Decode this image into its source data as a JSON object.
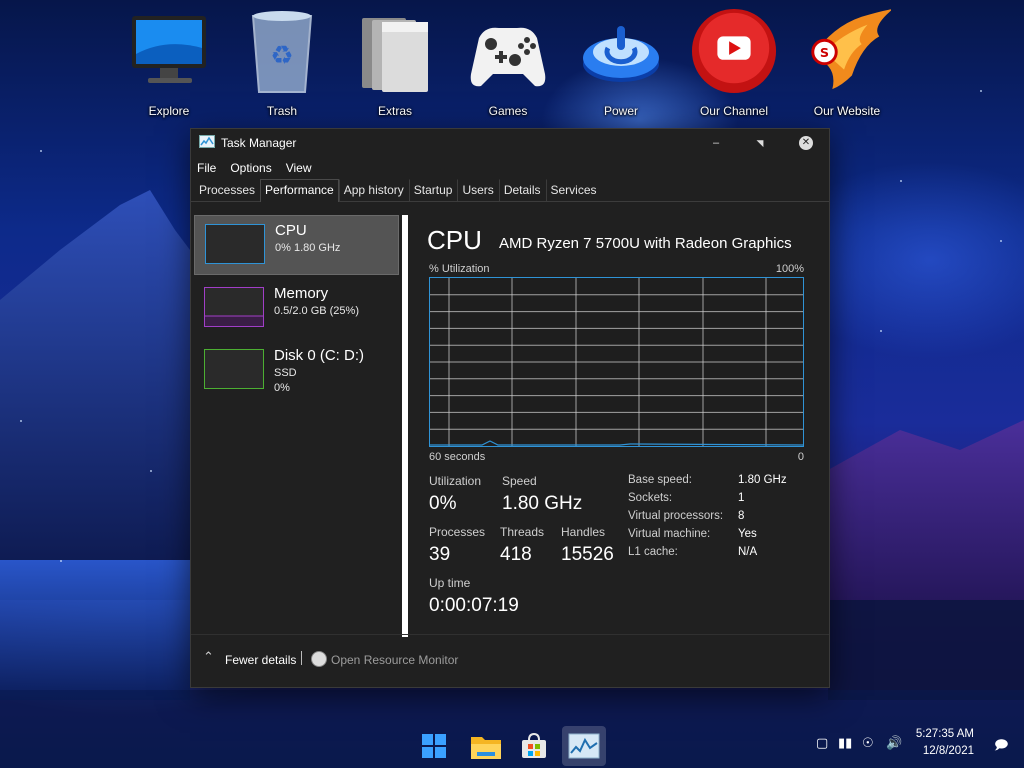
{
  "desktop": {
    "icons": [
      {
        "label": "Explore"
      },
      {
        "label": "Trash"
      },
      {
        "label": "Extras"
      },
      {
        "label": "Games"
      },
      {
        "label": "Power"
      },
      {
        "label": "Our Channel"
      },
      {
        "label": "Our Website"
      }
    ]
  },
  "window": {
    "title": "Task Manager",
    "menu": [
      "File",
      "Options",
      "View"
    ],
    "tabs": [
      "Processes",
      "Performance",
      "App history",
      "Startup",
      "Users",
      "Details",
      "Services"
    ],
    "active_tab": "Performance"
  },
  "sidebar": {
    "items": [
      {
        "name": "CPU",
        "line1": "0%  1.80 GHz",
        "line2": "",
        "color": "#2f93d6",
        "selected": true
      },
      {
        "name": "Memory",
        "line1": "0.5/2.0 GB (25%)",
        "line2": "",
        "color": "#a13ec8",
        "selected": false
      },
      {
        "name": "Disk 0 (C: D:)",
        "line1": "SSD",
        "line2": "0%",
        "color": "#4caf32",
        "selected": false
      }
    ]
  },
  "cpu": {
    "title": "CPU",
    "model": "AMD Ryzen 7 5700U with Radeon Graphics",
    "graph_label": "% Utilization",
    "graph_max": "100%",
    "graph_time": "60 seconds",
    "graph_min": "0",
    "stats": {
      "utilization_label": "Utilization",
      "utilization": "0%",
      "speed_label": "Speed",
      "speed": "1.80 GHz",
      "processes_label": "Processes",
      "processes": "39",
      "threads_label": "Threads",
      "threads": "418",
      "handles_label": "Handles",
      "handles": "15526",
      "uptime_label": "Up time",
      "uptime": "0:00:07:19"
    },
    "specs": [
      {
        "key": "Base speed:",
        "value": "1.80 GHz"
      },
      {
        "key": "Sockets:",
        "value": "1"
      },
      {
        "key": "Virtual processors:",
        "value": "8"
      },
      {
        "key": "Virtual machine:",
        "value": "Yes"
      },
      {
        "key": "L1 cache:",
        "value": "N/A"
      }
    ],
    "graph_color": "#2f93d6"
  },
  "footer": {
    "fewer_details": "Fewer details",
    "open_resource_monitor": "Open Resource Monitor"
  },
  "taskbar": {
    "time": "5:27:35 AM",
    "date": "12/8/2021",
    "icons": [
      "start-icon",
      "file-explorer-icon",
      "store-icon",
      "task-manager-icon"
    ]
  }
}
